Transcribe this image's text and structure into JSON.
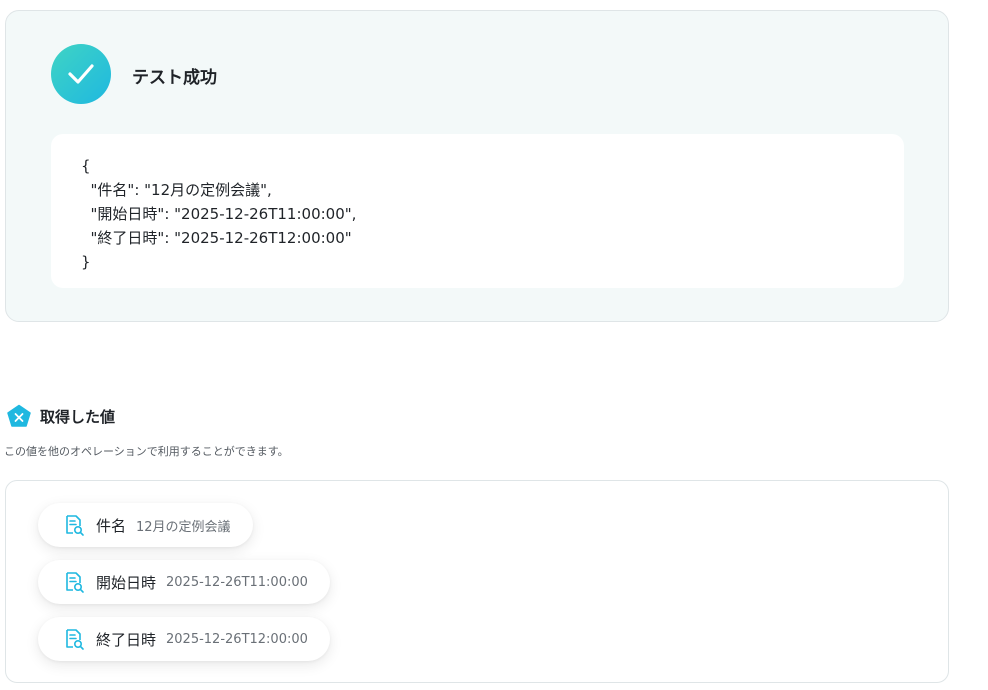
{
  "test_result": {
    "title": "テスト成功",
    "json_output": "{\n  \"件名\": \"12月の定例会議\",\n  \"開始日時\": \"2025-12-26T11:00:00\",\n  \"終了日時\": \"2025-12-26T12:00:00\"\n}"
  },
  "obtained_values": {
    "title": "取得した値",
    "description": "この値を他のオペレーションで利用することができます。",
    "icon": "x-hexagon-icon",
    "items": [
      {
        "key": "件名",
        "value": "12月の定例会議"
      },
      {
        "key": "開始日時",
        "value": "2025-12-26T11:00:00"
      },
      {
        "key": "終了日時",
        "value": "2025-12-26T12:00:00"
      }
    ]
  },
  "colors": {
    "accent": "#1fb8e0",
    "accent_light": "#3fd4c4",
    "panel_bg": "#f3f9f9"
  }
}
